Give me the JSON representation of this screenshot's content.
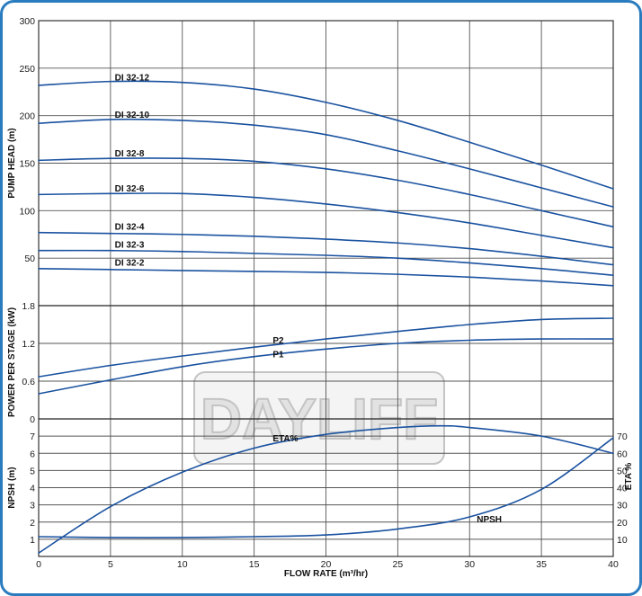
{
  "colors": {
    "frame": "#2b7bbf",
    "curve": "#1a52a0",
    "grid": "#555555",
    "watermark_fill": "#e2e2e2",
    "watermark_stroke": "#c4c4c4"
  },
  "watermark": {
    "text": "DAYLIFF"
  },
  "chart_data": {
    "type": "line",
    "x_axis": {
      "label": "FLOW RATE (m³/hr)",
      "range": [
        0,
        40
      ],
      "ticks": [
        "0",
        "5",
        "10",
        "15",
        "20",
        "25",
        "30",
        "35",
        "40"
      ]
    },
    "panels": [
      {
        "id": "head",
        "ylabel": "PUMP HEAD (m)",
        "ylim": [
          0,
          300
        ],
        "yticks": [
          {
            "value": 50,
            "label": "50"
          },
          {
            "value": 100,
            "label": "100"
          },
          {
            "value": 150,
            "label": "150"
          },
          {
            "value": 200,
            "label": "200"
          },
          {
            "value": 250,
            "label": "250"
          },
          {
            "value": 300,
            "label": "300"
          }
        ],
        "grid": true,
        "series": [
          {
            "name": "DI 32-12",
            "label_at": [
              5.3,
              237
            ],
            "x": [
              0,
              5,
              10,
              15,
              20,
              25,
              30,
              35,
              40
            ],
            "y": [
              232,
              236,
              235,
              228,
              214,
              195,
              172,
              148,
              123
            ]
          },
          {
            "name": "DI 32-10",
            "label_at": [
              5.3,
              198
            ],
            "x": [
              0,
              5,
              10,
              15,
              20,
              25,
              30,
              35,
              40
            ],
            "y": [
              192,
              196,
              195,
              190,
              180,
              163,
              144,
              124,
              104
            ]
          },
          {
            "name": "DI 32-8",
            "label_at": [
              5.3,
              157
            ],
            "x": [
              0,
              5,
              10,
              15,
              20,
              25,
              30,
              35,
              40
            ],
            "y": [
              153,
              155,
              155,
              152,
              144,
              132,
              117,
              100,
              83
            ]
          },
          {
            "name": "DI 32-6",
            "label_at": [
              5.3,
              120
            ],
            "x": [
              0,
              5,
              10,
              15,
              20,
              25,
              30,
              35,
              40
            ],
            "y": [
              117,
              118,
              118,
              114,
              107,
              98,
              87,
              74,
              61
            ]
          },
          {
            "name": "DI 32-4",
            "label_at": [
              5.3,
              80
            ],
            "x": [
              0,
              5,
              10,
              15,
              20,
              25,
              30,
              35,
              40
            ],
            "y": [
              77,
              76,
              75,
              73,
              70,
              66,
              60,
              52,
              43
            ]
          },
          {
            "name": "DI 32-3",
            "label_at": [
              5.3,
              61
            ],
            "x": [
              0,
              5,
              10,
              15,
              20,
              25,
              30,
              35,
              40
            ],
            "y": [
              58,
              58,
              57,
              55,
              53,
              50,
              45,
              39,
              32
            ]
          },
          {
            "name": "DI 32-2",
            "label_at": [
              5.3,
              42
            ],
            "x": [
              0,
              5,
              10,
              15,
              20,
              25,
              30,
              35,
              40
            ],
            "y": [
              39,
              38,
              37,
              36,
              35,
              33,
              30,
              26,
              21
            ]
          }
        ]
      },
      {
        "id": "power",
        "ylabel": "POWER PER STAGE (kW)",
        "ylim": [
          0,
          1.8
        ],
        "yticks": [
          {
            "value": 0,
            "label": "0"
          },
          {
            "value": 0.6,
            "label": "0.6"
          },
          {
            "value": 1.2,
            "label": "1.2"
          },
          {
            "value": 1.8,
            "label": "1.8"
          }
        ],
        "grid": true,
        "series": [
          {
            "name": "P2",
            "label_at": [
              16.3,
              1.2
            ],
            "x": [
              0,
              5,
              10,
              15,
              20,
              25,
              30,
              35,
              40
            ],
            "y": [
              0.67,
              0.85,
              1.0,
              1.14,
              1.27,
              1.39,
              1.5,
              1.58,
              1.6
            ]
          },
          {
            "name": "P1",
            "label_at": [
              16.3,
              0.98
            ],
            "x": [
              0,
              5,
              10,
              15,
              20,
              25,
              30,
              35,
              40
            ],
            "y": [
              0.4,
              0.62,
              0.83,
              0.99,
              1.11,
              1.2,
              1.25,
              1.27,
              1.27
            ]
          }
        ]
      },
      {
        "id": "npsh",
        "ylabel": "NPSH (m)",
        "ylim": [
          0,
          8
        ],
        "yticks": [
          {
            "value": 1,
            "label": "1"
          },
          {
            "value": 2,
            "label": "2"
          },
          {
            "value": 3,
            "label": "3"
          },
          {
            "value": 4,
            "label": "4"
          },
          {
            "value": 5,
            "label": "5"
          },
          {
            "value": 6,
            "label": "6"
          },
          {
            "value": 7,
            "label": "7"
          }
        ],
        "right_axis": {
          "ylabel": "ETA %",
          "ylim": [
            0,
            80
          ],
          "yticks": [
            {
              "value": 10,
              "label": "10"
            },
            {
              "value": 20,
              "label": "20"
            },
            {
              "value": 30,
              "label": "30"
            },
            {
              "value": 40,
              "label": "40"
            },
            {
              "value": 50,
              "label": "50"
            },
            {
              "value": 60,
              "label": "60"
            },
            {
              "value": 70,
              "label": "70"
            }
          ]
        },
        "grid": true,
        "series": [
          {
            "name": "ETA%",
            "axis": "right",
            "label_at": [
              16.3,
              67
            ],
            "x": [
              0,
              5,
              10,
              15,
              20,
              25,
              28,
              30,
              35,
              40
            ],
            "y": [
              2,
              29,
              49,
              63,
              71,
              75,
              76,
              75,
              70,
              60
            ]
          },
          {
            "name": "NPSH",
            "axis": "left",
            "label_at": [
              30.5,
              2.0
            ],
            "x": [
              0,
              5,
              10,
              15,
              20,
              25,
              30,
              35,
              40
            ],
            "y": [
              1.15,
              1.1,
              1.1,
              1.15,
              1.25,
              1.6,
              2.3,
              3.9,
              6.9
            ]
          }
        ]
      }
    ]
  }
}
